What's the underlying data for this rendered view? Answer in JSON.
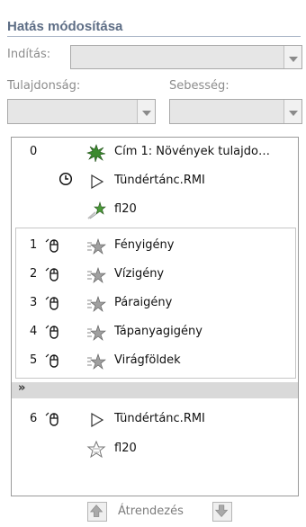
{
  "panel": {
    "title": "Hatás módosítása",
    "start_label": "Indítás:",
    "property_label": "Tulajdonság:",
    "speed_label": "Sebesség:"
  },
  "list": {
    "rows": [
      {
        "num": "0",
        "name": "Cím 1: Növények tulajdo…"
      },
      {
        "num": "",
        "name": "Tündértánc.RMI"
      },
      {
        "num": "",
        "name": "fl20"
      },
      {
        "num": "1",
        "name": "Fényigény"
      },
      {
        "num": "2",
        "name": "Vízigény"
      },
      {
        "num": "3",
        "name": "Páraigény"
      },
      {
        "num": "4",
        "name": "Tápanyagigény"
      },
      {
        "num": "5",
        "name": "Virágföldek"
      },
      {
        "num": "6",
        "name": "Tündértánc.RMI"
      },
      {
        "num": "",
        "name": "fl20"
      }
    ],
    "collapse_icon": "double-chevron-up-icon"
  },
  "reorder": {
    "label": "Átrendezés",
    "up_icon": "arrow-up-icon",
    "down_icon": "arrow-down-icon"
  }
}
